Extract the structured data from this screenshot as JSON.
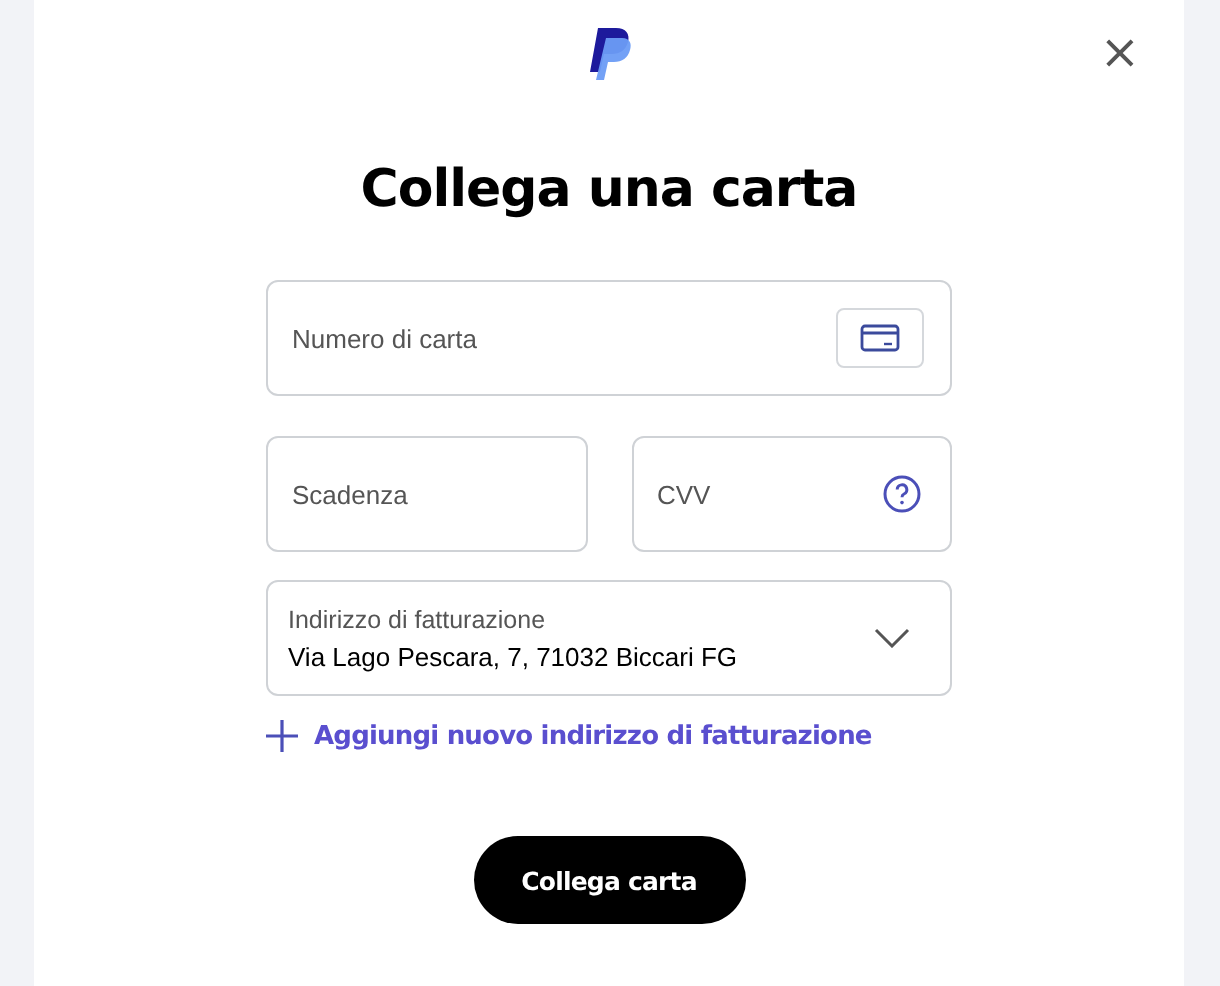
{
  "close_label": "×",
  "title": "Collega una carta",
  "card_number": {
    "placeholder": "Numero di carta"
  },
  "expiry": {
    "placeholder": "Scadenza"
  },
  "cvv": {
    "placeholder": "CVV"
  },
  "billing_address": {
    "label": "Indirizzo di fatturazione",
    "value": "Via Lago Pescara, 7, 71032 Biccari FG"
  },
  "add_address_link": "Aggiungi nuovo indirizzo di fatturazione",
  "submit_button": "Collega carta"
}
